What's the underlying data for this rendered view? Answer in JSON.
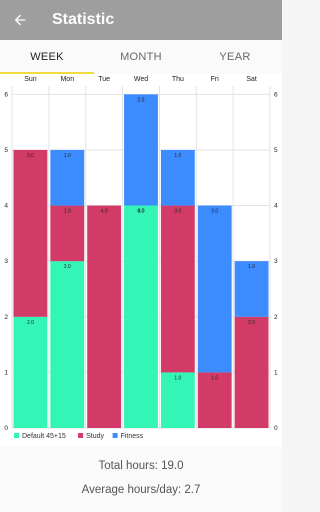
{
  "appbar": {
    "title": "Statistic",
    "back_icon": "arrow-back-icon"
  },
  "tabs": [
    {
      "label": "WEEK",
      "active": true
    },
    {
      "label": "MONTH",
      "active": false
    },
    {
      "label": "YEAR",
      "active": false
    }
  ],
  "stats": {
    "total": "Total hours: 19.0",
    "average": "Average hours/day: 2.7"
  },
  "colors": {
    "default": "#33f5b6",
    "study": "#d23a67",
    "fitness": "#3d8cff",
    "tab_indicator": "#f0dc3c"
  },
  "chart_data": {
    "type": "bar",
    "stacked": true,
    "categories": [
      "Sun",
      "Mon",
      "Tue",
      "Wed",
      "Thu",
      "Fri",
      "Sat"
    ],
    "series": [
      {
        "name": "Default 45+15",
        "color": "#33f5b6",
        "values": [
          2,
          3,
          0,
          4,
          1,
          0,
          0
        ]
      },
      {
        "name": "Study",
        "color": "#d23a67",
        "values": [
          3,
          1,
          4,
          0,
          3,
          1,
          2
        ]
      },
      {
        "name": "Fitness",
        "color": "#3d8cff",
        "values": [
          0,
          1,
          0,
          2,
          1,
          3,
          1
        ]
      }
    ],
    "segment_labels": [
      [
        "2.0",
        "3.0",
        ""
      ],
      [
        "3.0",
        "1.0",
        "1.0"
      ],
      [
        "0.0",
        "4.0",
        ""
      ],
      [
        "4.0",
        "0.0",
        "2.0"
      ],
      [
        "1.0",
        "3.0",
        "1.0"
      ],
      [
        "0.0",
        "1.0",
        "3.0"
      ],
      [
        "0.0",
        "2.0",
        "1.0"
      ]
    ],
    "yticks": [
      0,
      1,
      2,
      3,
      4,
      5,
      6
    ],
    "ylim": [
      0,
      6.15
    ],
    "grid": true,
    "legend": "bottom-left"
  }
}
